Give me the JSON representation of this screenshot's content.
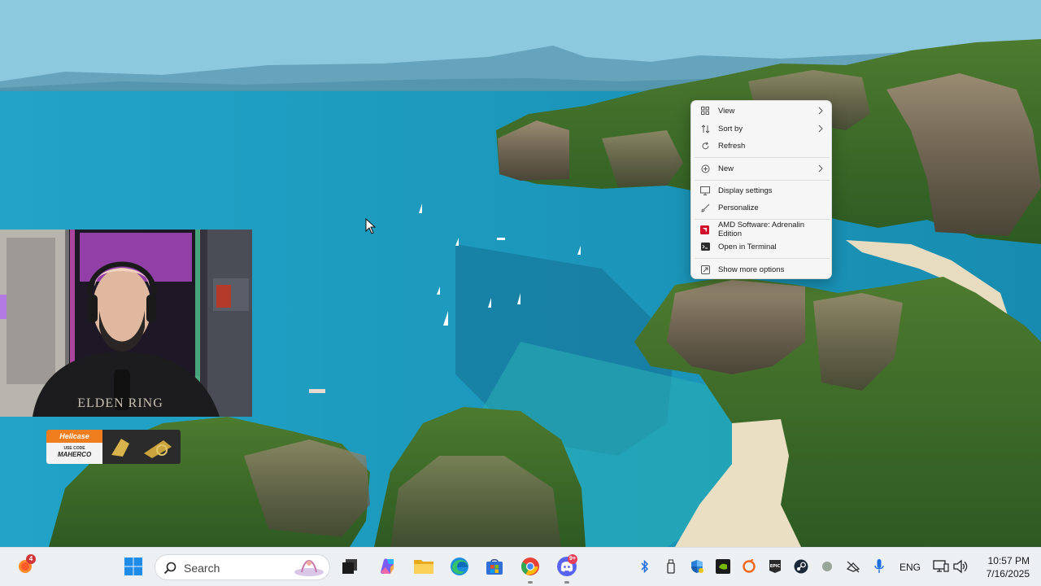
{
  "context_menu": {
    "items": [
      {
        "label": "View",
        "icon": "view-grid-icon",
        "submenu": true
      },
      {
        "label": "Sort by",
        "icon": "sort-icon",
        "submenu": true
      },
      {
        "label": "Refresh",
        "icon": "refresh-icon",
        "submenu": false
      },
      {
        "label": "New",
        "icon": "new-plus-icon",
        "submenu": true
      },
      {
        "label": "Display settings",
        "icon": "display-icon",
        "submenu": false
      },
      {
        "label": "Personalize",
        "icon": "personalize-brush-icon",
        "submenu": false
      },
      {
        "label": "AMD Software: Adrenalin Edition",
        "icon": "amd-icon",
        "submenu": false
      },
      {
        "label": "Open in Terminal",
        "icon": "terminal-icon",
        "submenu": false
      },
      {
        "label": "Show more options",
        "icon": "more-options-icon",
        "submenu": false
      }
    ]
  },
  "webcam": {
    "shirt_text": "ELDEN RING"
  },
  "promo": {
    "brand": "Hellcase",
    "code_label": "USE CODE",
    "code": "MAHERCO"
  },
  "taskbar": {
    "weather_badge": "4",
    "search_placeholder": "Search",
    "discord_badge": "9+",
    "language": "ENG",
    "time": "10:57 PM",
    "date": "7/16/2025",
    "pinned": [
      "windows-start-icon",
      "task-view-icon",
      "copilot-icon",
      "file-explorer-icon",
      "edge-icon",
      "microsoft-store-icon",
      "chrome-icon",
      "discord-icon"
    ],
    "tray": [
      "bluetooth-icon",
      "usb-device-icon",
      "defender-icon",
      "nvidia-icon",
      "origin-icon",
      "epic-games-icon",
      "steam-icon",
      "status-dot-icon",
      "network-hidden-icon",
      "microphone-icon",
      "monitor-network-icon",
      "volume-icon"
    ]
  },
  "colors": {
    "taskbar_bg": "#ecf0f2",
    "menu_bg": "#f6f6f7",
    "hellcase_orange": "#f07d1e",
    "chrome_red": "#ea4335",
    "discord_blurple": "#5865f2"
  }
}
